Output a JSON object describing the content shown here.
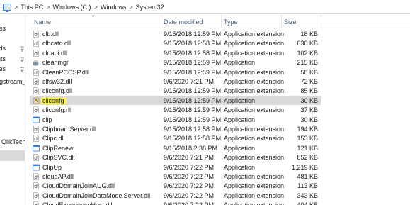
{
  "breadcrumb": {
    "items": [
      "This PC",
      "Windows (C:)",
      "Windows",
      "System32"
    ],
    "separator": ">"
  },
  "nav": {
    "items": [
      {
        "label": "ss",
        "pinned": false
      },
      {
        "label": "ds",
        "pinned": true
      },
      {
        "label": "nts",
        "pinned": true
      },
      {
        "label": "es",
        "pinned": true
      },
      {
        "label": "gstream_tom",
        "pinned": false
      },
      {
        "label": "QlikTech Ir",
        "pinned": false
      }
    ]
  },
  "columns": {
    "name": "Name",
    "date": "Date modified",
    "type": "Type",
    "size": "Size"
  },
  "files": [
    {
      "name": "clb.dll",
      "date": "9/15/2018 12:59 PM",
      "type": "Application extension",
      "size": "18 KB",
      "icon": "dll-icon",
      "selected": false
    },
    {
      "name": "clbcatq.dll",
      "date": "9/15/2018 12:58 PM",
      "type": "Application extension",
      "size": "630 KB",
      "icon": "dll-icon",
      "selected": false
    },
    {
      "name": "cldapi.dll",
      "date": "9/15/2018 12:58 PM",
      "type": "Application extension",
      "size": "102 KB",
      "icon": "dll-icon",
      "selected": false
    },
    {
      "name": "cleanmgr",
      "date": "9/15/2018 12:59 PM",
      "type": "Application",
      "size": "215 KB",
      "icon": "cleanmgr-icon",
      "selected": false
    },
    {
      "name": "CleanPCCSP.dll",
      "date": "9/15/2018 12:59 PM",
      "type": "Application extension",
      "size": "58 KB",
      "icon": "dll-icon",
      "selected": false
    },
    {
      "name": "clfsw32.dll",
      "date": "9/6/2020 7:21 PM",
      "type": "Application extension",
      "size": "72 KB",
      "icon": "dll-icon",
      "selected": false
    },
    {
      "name": "cliconfg.dll",
      "date": "9/15/2018 12:59 PM",
      "type": "Application extension",
      "size": "85 KB",
      "icon": "dll-icon",
      "selected": false
    },
    {
      "name": "cliconfg",
      "date": "9/15/2018 12:59 PM",
      "type": "Application",
      "size": "30 KB",
      "icon": "cliconfg-icon",
      "selected": true,
      "highlighted": true
    },
    {
      "name": "cliconfg.rll",
      "date": "9/15/2018 12:59 PM",
      "type": "Application extension",
      "size": "37 KB",
      "icon": "dll-icon",
      "selected": false
    },
    {
      "name": "clip",
      "date": "9/15/2018 12:59 PM",
      "type": "Application",
      "size": "30 KB",
      "icon": "exe-icon",
      "selected": false
    },
    {
      "name": "ClipboardServer.dll",
      "date": "9/15/2018 12:58 PM",
      "type": "Application extension",
      "size": "194 KB",
      "icon": "dll-icon",
      "selected": false
    },
    {
      "name": "Clipc.dll",
      "date": "9/15/2018 12:58 PM",
      "type": "Application extension",
      "size": "153 KB",
      "icon": "dll-icon",
      "selected": false
    },
    {
      "name": "ClipRenew",
      "date": "9/15/2018 2:38 PM",
      "type": "Application",
      "size": "121 KB",
      "icon": "exe-icon",
      "selected": false
    },
    {
      "name": "ClipSVC.dll",
      "date": "9/6/2020 7:21 PM",
      "type": "Application extension",
      "size": "852 KB",
      "icon": "dll-icon",
      "selected": false
    },
    {
      "name": "ClipUp",
      "date": "9/6/2020 7:22 PM",
      "type": "Application",
      "size": "1,219 KB",
      "icon": "exe-icon",
      "selected": false
    },
    {
      "name": "cloudAP.dll",
      "date": "9/6/2020 7:22 PM",
      "type": "Application extension",
      "size": "481 KB",
      "icon": "dll-icon",
      "selected": false
    },
    {
      "name": "CloudDomainJoinAUG.dll",
      "date": "9/6/2020 7:22 PM",
      "type": "Application extension",
      "size": "113 KB",
      "icon": "dll-icon",
      "selected": false
    },
    {
      "name": "CloudDomainJoinDataModelServer.dll",
      "date": "9/6/2020 7:22 PM",
      "type": "Application extension",
      "size": "343 KB",
      "icon": "dll-icon",
      "selected": false
    },
    {
      "name": "CloudExperienceHost.dll",
      "date": "9/6/2020 7:22 PM",
      "type": "Application extension",
      "size": "404 KB",
      "icon": "dll-icon",
      "selected": false
    }
  ],
  "colors": {
    "selected_row": "#d9d9d9",
    "highlight": "#f6f45a",
    "header_text": "#4c607a"
  }
}
